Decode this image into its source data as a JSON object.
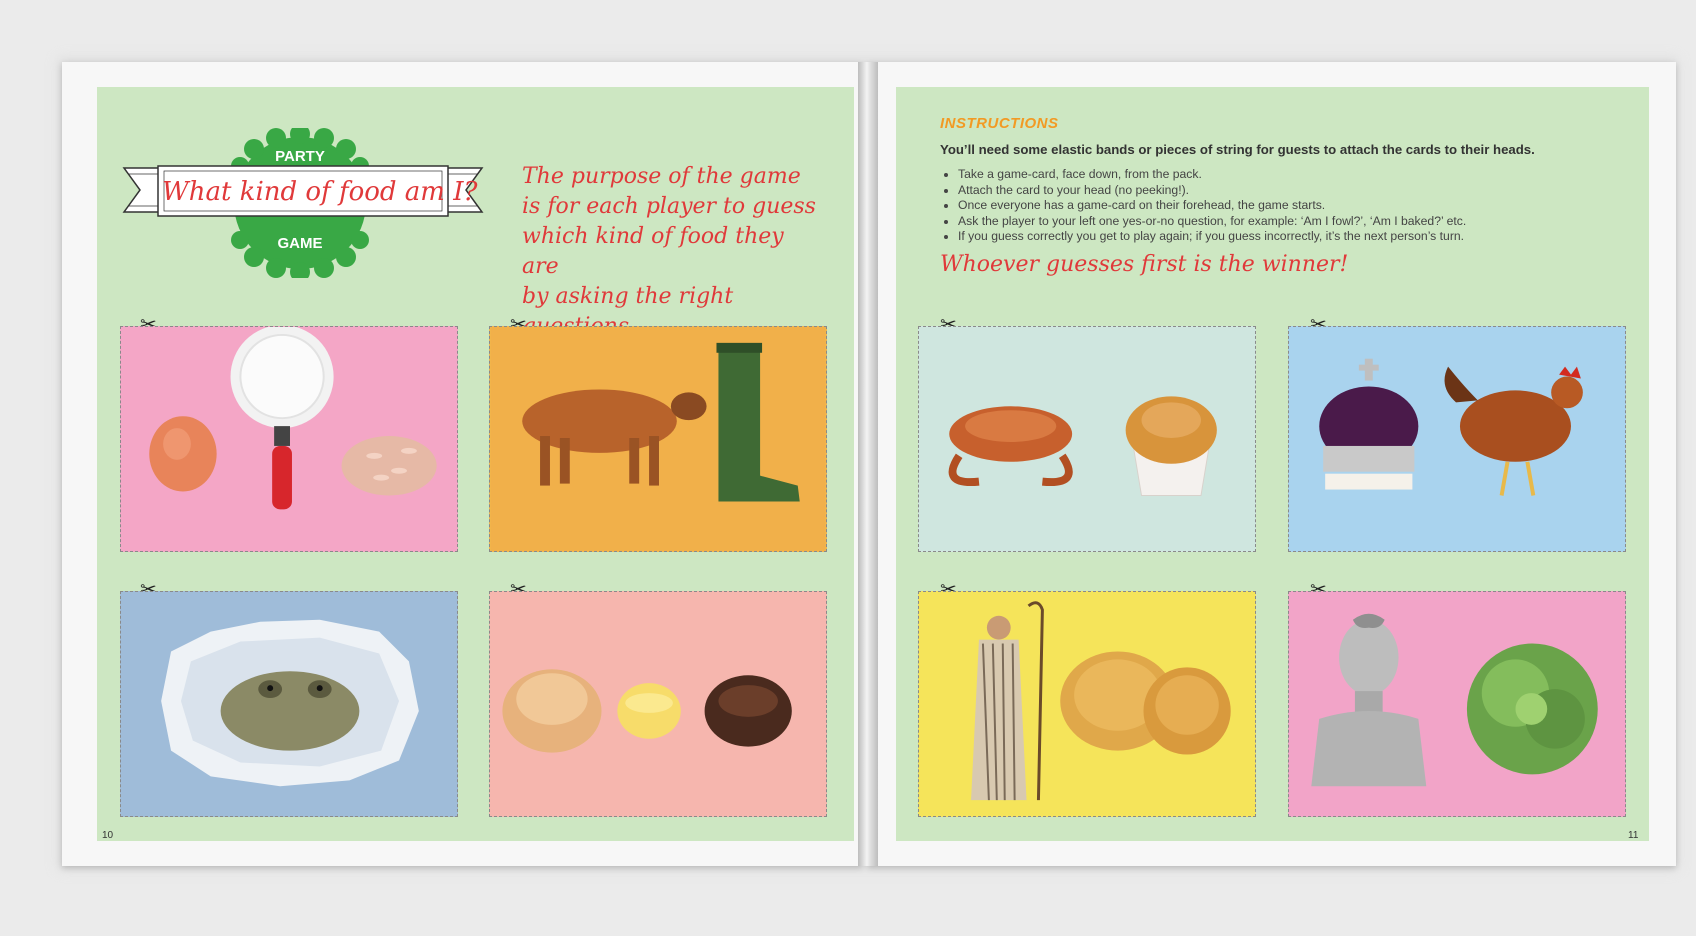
{
  "left_page": {
    "badge": {
      "top_word": "PARTY",
      "title": "What kind of food am I?",
      "bottom_word": "GAME"
    },
    "purpose_lines": [
      "The purpose of the game",
      "is for each player to guess",
      "which kind of food they are",
      "by asking the right questions."
    ],
    "page_number": "10",
    "cards": [
      {
        "name": "card-egg-pan-rice",
        "background": "#f4a6c6",
        "depicts": "egg, frying pan, rice"
      },
      {
        "name": "card-cow-boot",
        "background": "#f2b84a",
        "depicts": "cow, wellington boot"
      },
      {
        "name": "card-toad",
        "background": "#9fbcd9",
        "depicts": "toad in torn paper"
      },
      {
        "name": "card-bread-butter-pudding",
        "background": "#f6b6ae",
        "depicts": "bread roll, butter, pudding"
      }
    ]
  },
  "right_page": {
    "instructions": {
      "heading": "INSTRUCTIONS",
      "lead": "You’ll need some elastic bands or pieces of string for guests to attach the cards to their heads.",
      "steps": [
        "Take a game-card, face down, from the pack.",
        "Attach the card to your head (no peeking!).",
        "Once everyone has a game-card on their forehead, the game starts.",
        "Ask the player to your left one yes-or-no question, for example: ‘Am I fowl?’, ‘Am I baked?’ etc.",
        "If you guess correctly you get to play again; if you guess incorrectly, it’s the next person’s turn."
      ]
    },
    "winner": "Whoever guesses first is the winner!",
    "page_number": "11",
    "cards": [
      {
        "name": "card-crab-muffin",
        "background": "#cfe6df",
        "depicts": "crab, muffin"
      },
      {
        "name": "card-crown-hen",
        "background": "#a9d3ee",
        "depicts": "crown, hen"
      },
      {
        "name": "card-shepherd-pie",
        "background": "#f5e45a",
        "depicts": "shepherd, pie"
      },
      {
        "name": "card-bust-lettuce",
        "background": "#f2a4c8",
        "depicts": "Caesar bust, lettuce"
      }
    ]
  },
  "colors": {
    "panel_green": "#cde7c2",
    "title_red": "#e0393a",
    "heading_orange": "#f29a24",
    "badge_green": "#39a845"
  },
  "icons": {
    "cut_line": "scissors-icon"
  }
}
